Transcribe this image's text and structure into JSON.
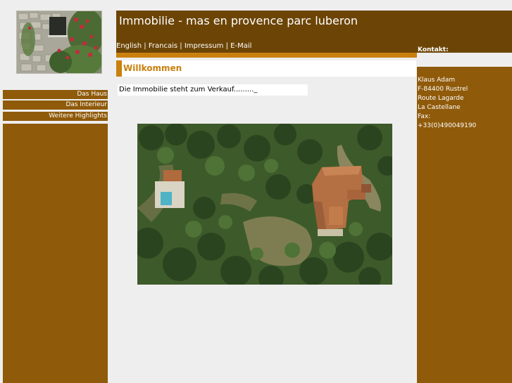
{
  "header": {
    "title": "Immobilie - mas en provence parc luberon",
    "languages": [
      "English",
      "Francais",
      "Impressum",
      "E-Mail"
    ],
    "separator": "|"
  },
  "nav": {
    "items": [
      {
        "label": "Das Haus"
      },
      {
        "label": "Das Interieur"
      },
      {
        "label": "Weitere Highlights"
      }
    ]
  },
  "main": {
    "welcome_title": "Willkommen",
    "sale_text": "Die Immobilie steht zum Verkauf.........",
    "sale_cursor": "_"
  },
  "contact": {
    "label": "Kontakt:",
    "lines": [
      "Klaus Adam",
      "F-84400 Rustrel",
      "Route Lagarde",
      "La Castellane",
      "Fax:",
      "+33(0)490049190"
    ]
  },
  "colors": {
    "dark_brown": "#6c4506",
    "brown": "#8f5a0a",
    "orange": "#c9800d",
    "background": "#eeeeee"
  }
}
